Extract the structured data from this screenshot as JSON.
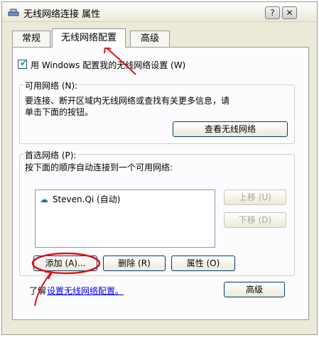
{
  "window": {
    "title": "无线网络连接 属性",
    "help_button": "?",
    "close_button": "✕"
  },
  "tabs": [
    {
      "label": "常规"
    },
    {
      "label": "无线网络配置"
    },
    {
      "label": "高级"
    }
  ],
  "use_windows": {
    "label": "用 Windows 配置我的无线网络设置 (W)",
    "checked": true
  },
  "available": {
    "legend": "可用网络 (N):",
    "description_line1": "要连接、断开区域内无线网络或查找有关更多信息，请",
    "description_line2": "单击下面的按钮。",
    "view_button": "查看无线网络"
  },
  "preferred": {
    "legend": "首选网络 (P):",
    "description": "按下面的顺序自动连接到一个可用网络:",
    "networks": [
      {
        "name": "Steven.Qi (自动)",
        "icon": "wireless-network-icon"
      }
    ],
    "move_up": "上移 (U)",
    "move_down": "下移 (D)",
    "add": "添加 (A)...",
    "remove": "删除 (R)",
    "properties": "属性 (O)"
  },
  "learn": {
    "prefix": "了解",
    "link": "设置无线网络配置。"
  },
  "advanced_button": "高级"
}
